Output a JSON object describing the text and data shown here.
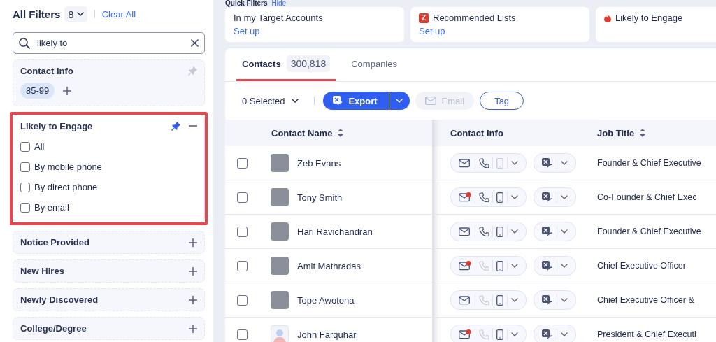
{
  "sidebar": {
    "title": "All Filters",
    "count": "8",
    "clear": "Clear All",
    "search": {
      "value": "likely to"
    },
    "filters": [
      {
        "kind": "chips",
        "title": "Contact Info",
        "pinned": false,
        "chips": [
          "85-99"
        ]
      },
      {
        "kind": "options",
        "title": "Likely to Engage",
        "pinned": true,
        "expanded": true,
        "highlighted": true,
        "options": [
          {
            "label": "All",
            "checked": false
          },
          {
            "label": "By mobile phone",
            "checked": false
          },
          {
            "label": "By direct phone",
            "checked": false
          },
          {
            "label": "By email",
            "checked": false
          }
        ]
      },
      {
        "kind": "collapsed",
        "title": "Notice Provided",
        "expanded": false
      },
      {
        "kind": "collapsed",
        "title": "New Hires",
        "expanded": false
      },
      {
        "kind": "collapsed",
        "title": "Newly Discovered",
        "expanded": false
      },
      {
        "kind": "collapsed",
        "title": "College/Degree",
        "expanded": false
      }
    ]
  },
  "quick_filters": {
    "title": "Quick Filters",
    "action": "Hide",
    "cards": [
      {
        "kind": "plain",
        "title": "In my Target Accounts",
        "link": "Set up"
      },
      {
        "kind": "logo",
        "title": "Recommended Lists",
        "logo_letter": "Z",
        "link": "Set up"
      },
      {
        "kind": "flame",
        "title": "Likely to Engage"
      }
    ]
  },
  "tabs": [
    {
      "label": "Contacts",
      "count": "300,818",
      "selected": true
    },
    {
      "label": "Companies",
      "selected": false
    }
  ],
  "toolbar": {
    "selection": "0 Selected",
    "export": "Export",
    "email": {
      "label": "Email",
      "disabled": true
    },
    "tag": "Tag"
  },
  "table": {
    "columns": [
      {
        "label": "Contact Name",
        "sortable": true
      },
      {
        "label": "Contact Info",
        "sortable": false
      },
      {
        "label": "Job Title",
        "sortable": true
      }
    ],
    "rows": [
      {
        "name": "Zeb Evans",
        "kind": "photo",
        "checked": false,
        "email_engaged": false,
        "phone_available": true,
        "mobile_available": false,
        "title": "Founder & Chief Executive"
      },
      {
        "name": "Tony Smith",
        "kind": "photo",
        "checked": false,
        "email_engaged": true,
        "phone_available": true,
        "mobile_available": true,
        "title": "Co-Founder & Chief Exec"
      },
      {
        "name": "Hari Ravichandran",
        "kind": "photo",
        "checked": false,
        "email_engaged": false,
        "phone_available": true,
        "mobile_available": true,
        "title": "Founder & Chief Executive"
      },
      {
        "name": "Amit Mathradas",
        "kind": "photo",
        "checked": false,
        "email_engaged": true,
        "phone_available": false,
        "mobile_available": true,
        "title": "Chief Executive Officer"
      },
      {
        "name": "Tope Awotona",
        "kind": "photo",
        "checked": false,
        "email_engaged": false,
        "phone_available": false,
        "mobile_available": true,
        "title": "Chief Executive Officer &"
      },
      {
        "name": "John Farquhar",
        "kind": "generic",
        "checked": false,
        "email_engaged": true,
        "phone_available": false,
        "mobile_available": true,
        "title": "President & Chief Executi"
      }
    ]
  }
}
